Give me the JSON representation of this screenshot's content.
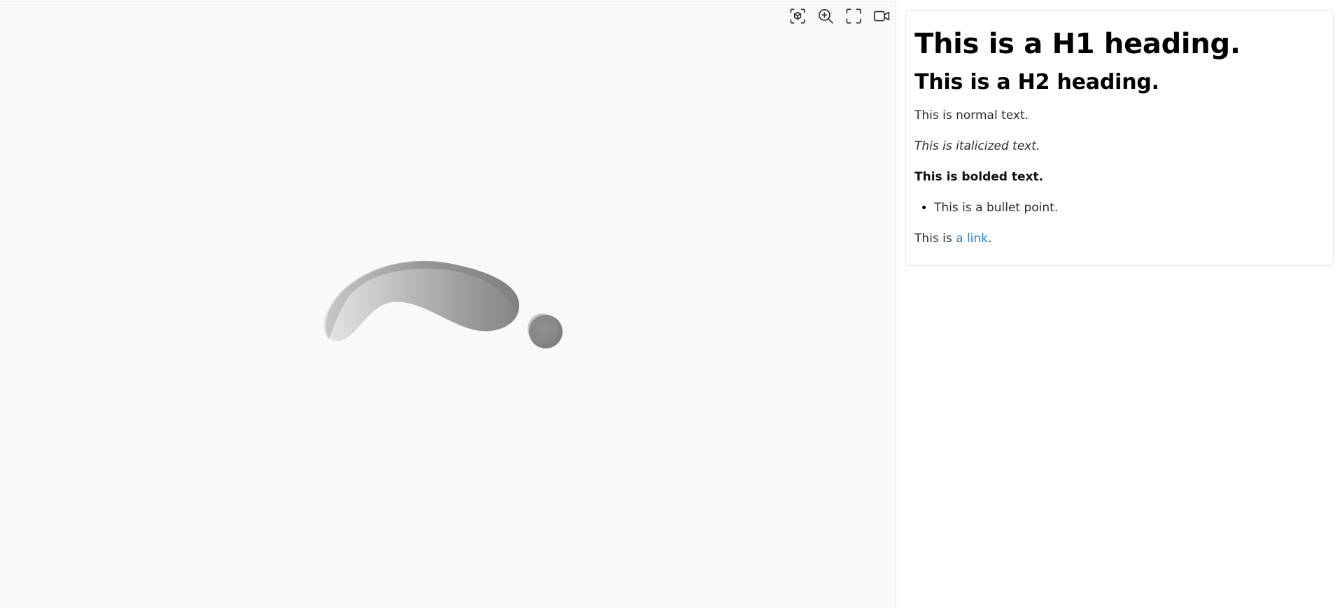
{
  "toolbar": {
    "buttons": [
      {
        "icon": "ar-view-icon"
      },
      {
        "icon": "zoom-in-icon"
      },
      {
        "icon": "fullscreen-icon"
      },
      {
        "icon": "video-camera-icon"
      }
    ]
  },
  "colors": {
    "viewer_background": "#f7f9fb",
    "model_shade": "#8c8c8c",
    "link": "#1a7fe0"
  },
  "content": {
    "h1": "This is a H1 heading.",
    "h2": "This is a H2 heading.",
    "normal": "This is normal text.",
    "italic": "This is italicized text.",
    "bold": "This is bolded text.",
    "bullets": [
      "This is a bullet point."
    ],
    "link_prefix": "This is ",
    "link_text": "a link",
    "link_suffix": "."
  }
}
